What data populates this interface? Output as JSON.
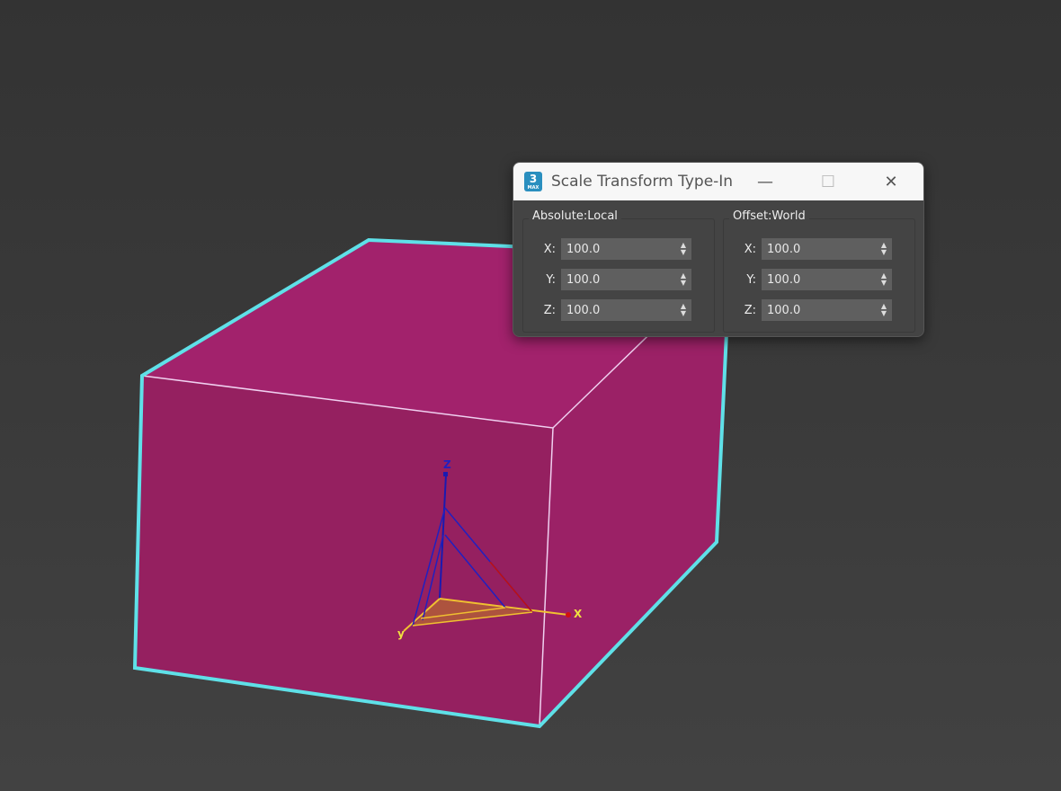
{
  "dialog": {
    "title": "Scale Transform Type-In",
    "app_icon": {
      "number": "3",
      "sub": "MAX"
    },
    "controls": {
      "minimize": "—",
      "maximize": "☐",
      "close": "✕"
    },
    "groups": [
      {
        "label": "Absolute:Local",
        "fields": [
          {
            "axis": "X:",
            "value": "100.0"
          },
          {
            "axis": "Y:",
            "value": "100.0"
          },
          {
            "axis": "Z:",
            "value": "100.0"
          }
        ]
      },
      {
        "label": "Offset:World",
        "fields": [
          {
            "axis": "X:",
            "value": "100.0"
          },
          {
            "axis": "Y:",
            "value": "100.0"
          },
          {
            "axis": "Z:",
            "value": "100.0"
          }
        ]
      }
    ]
  },
  "gizmo": {
    "x_label": "X",
    "y_label": "y",
    "z_label": "Z"
  },
  "colors": {
    "selection": "#5fe0e8",
    "object": "#9a2064",
    "x_axis": "#d01010",
    "y_axis": "#f0c030",
    "z_axis": "#1a1ab0"
  }
}
